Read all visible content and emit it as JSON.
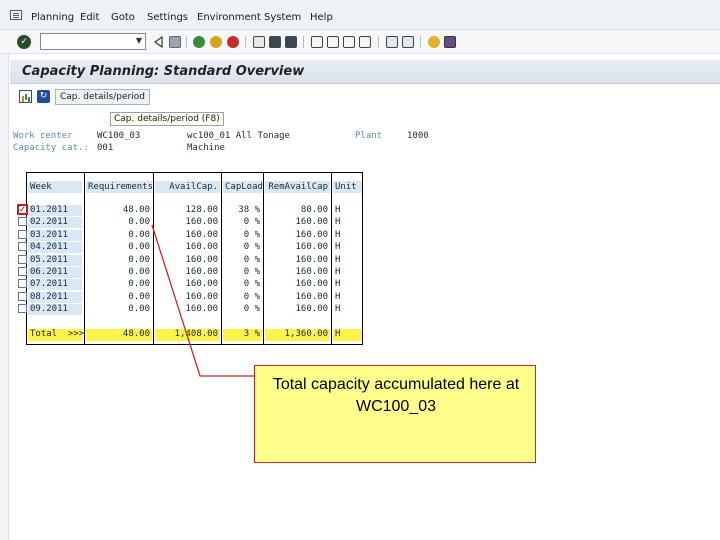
{
  "menu": {
    "items": [
      "Planning",
      "Edit",
      "Goto",
      "Settings",
      "Environment",
      "System",
      "Help"
    ]
  },
  "toolbar": {
    "command_field_value": "",
    "icons": [
      "enter-icon",
      "back-icon",
      "save-icon",
      "back-green-icon",
      "exit-icon",
      "cancel-icon",
      "print-icon",
      "find-icon",
      "find-next-icon",
      "first-page-icon",
      "previous-page-icon",
      "next-page-icon",
      "last-page-icon",
      "create-session-icon",
      "shortcut-icon",
      "help-icon",
      "layout-icon"
    ]
  },
  "page": {
    "title": "Capacity Planning: Standard Overview"
  },
  "app_toolbar": {
    "cap_details_label": "Cap. details/period",
    "tooltip": "Cap. details/period  (F8)"
  },
  "header": {
    "work_center_label": "Work center",
    "work_center_value": "WC100_03",
    "work_center_desc": "wc100_01 All Tonage",
    "plant_label": "Plant",
    "plant_value": "1000",
    "capacity_cat_label": "Capacity cat.:",
    "capacity_cat_value": "001",
    "capacity_cat_desc": "Machine"
  },
  "table": {
    "columns": [
      "Week",
      "Requirements",
      "AvailCap.",
      "CapLoad",
      "RemAvailCap",
      "Unit"
    ],
    "rows": [
      {
        "week": "01.2011",
        "req": "48.00",
        "avail": "128.00",
        "load": "38 %",
        "rem": "80.00",
        "unit": "H",
        "checked": true
      },
      {
        "week": "02.2011",
        "req": "0.00",
        "avail": "160.00",
        "load": "0 %",
        "rem": "160.00",
        "unit": "H",
        "checked": false
      },
      {
        "week": "03.2011",
        "req": "0.00",
        "avail": "160.00",
        "load": "0 %",
        "rem": "160.00",
        "unit": "H",
        "checked": false
      },
      {
        "week": "04.2011",
        "req": "0.00",
        "avail": "160.00",
        "load": "0 %",
        "rem": "160.00",
        "unit": "H",
        "checked": false
      },
      {
        "week": "05.2011",
        "req": "0.00",
        "avail": "160.00",
        "load": "0 %",
        "rem": "160.00",
        "unit": "H",
        "checked": false
      },
      {
        "week": "06.2011",
        "req": "0.00",
        "avail": "160.00",
        "load": "0 %",
        "rem": "160.00",
        "unit": "H",
        "checked": false
      },
      {
        "week": "07.2011",
        "req": "0.00",
        "avail": "160.00",
        "load": "0 %",
        "rem": "160.00",
        "unit": "H",
        "checked": false
      },
      {
        "week": "08.2011",
        "req": "0.00",
        "avail": "160.00",
        "load": "0 %",
        "rem": "160.00",
        "unit": "H",
        "checked": false
      },
      {
        "week": "09.2011",
        "req": "0.00",
        "avail": "160.00",
        "load": "0 %",
        "rem": "160.00",
        "unit": "H",
        "checked": false
      }
    ],
    "total": {
      "week": "Total  >>>",
      "req": "48.00",
      "avail": "1,408.00",
      "load": "3 %",
      "rem": "1,360.00",
      "unit": "H"
    }
  },
  "callout": {
    "text": "Total capacity accumulated here at WC100_03"
  },
  "colors": {
    "callout_fill": "#ffff8c",
    "callout_border": "#c82a2a",
    "total_row": "#fff24a",
    "header_blue": "#d9e8f5"
  }
}
